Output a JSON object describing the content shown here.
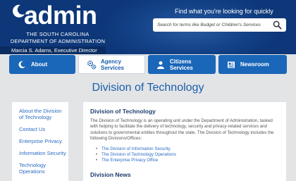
{
  "header": {
    "logo_word": "admin",
    "logo_line1": "THE SOUTH CAROLINA",
    "logo_line2": "DEPARTMENT OF ADMINISTRATION",
    "director": "Marcia S. Adams, Executive Director",
    "find_text": "Find what you're looking for quickly",
    "search_placeholder": "Search for terms like Budget or Children's Services",
    "search_icon": "magnifier-icon"
  },
  "nav": {
    "tabs": [
      {
        "label": "About",
        "icon": "moon-icon",
        "active": false
      },
      {
        "label": "Agency Services",
        "icon": "gears-icon",
        "active": true
      },
      {
        "label": "Citizens Services",
        "icon": "person-icon",
        "active": false
      },
      {
        "label": "Newsroom",
        "icon": "newspaper-icon",
        "active": false
      }
    ]
  },
  "page": {
    "title": "Division of Technology"
  },
  "sidebar": {
    "items": [
      {
        "label": "About the Division of Technology"
      },
      {
        "label": "Contact Us"
      },
      {
        "label": "Enterprise Privacy"
      },
      {
        "label": "Information Security"
      },
      {
        "label": "Technology Operations"
      }
    ]
  },
  "content": {
    "heading": "Division of Technology",
    "paragraph": "The Division of Technology is an operating unit under the Department of Administration, tasked with helping to facilitate the delivery of technology, security and privacy-related services and solutions to governmental entities throughout the state. The Division of Technology includes the following Divisions/Offices:",
    "links": [
      {
        "label": "The Division of Information Security"
      },
      {
        "label": "The Division of Technology Operations"
      },
      {
        "label": "The Enterprise Privacy Office"
      }
    ],
    "news_heading": "Division News"
  },
  "colors": {
    "header_bg": "#0d3778",
    "tab_bg": "#1a66b8",
    "link": "#2b6cc4",
    "title": "#1a5faa",
    "page_bg": "#e3e4e6"
  }
}
